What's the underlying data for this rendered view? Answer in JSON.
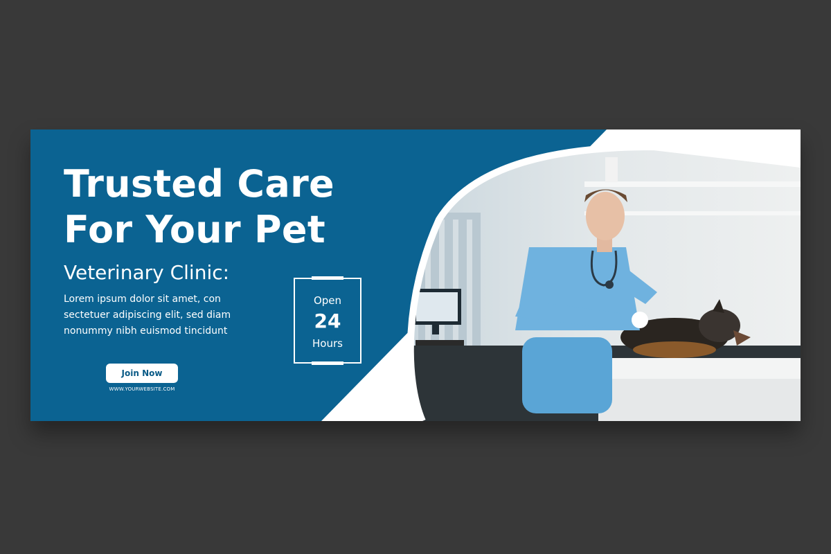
{
  "banner": {
    "headline_line1": "Trusted Care",
    "headline_line2": "For Your Pet",
    "subtitle": "Veterinary Clinic:",
    "body_line1": "Lorem ipsum dolor sit amet, con",
    "body_line2": "sectetuer adipiscing elit, sed diam",
    "body_line3": "nonummy nibh euismod tincidunt",
    "cta_label": "Join Now",
    "website": "WWW.YOURWEBSITE.COM",
    "hours": {
      "open": "Open",
      "number": "24",
      "unit": "Hours"
    },
    "photo_icon": "vet-with-dog-photo"
  },
  "colors": {
    "page_background": "#393939",
    "brand_blue": "#0b6392",
    "white": "#ffffff"
  }
}
